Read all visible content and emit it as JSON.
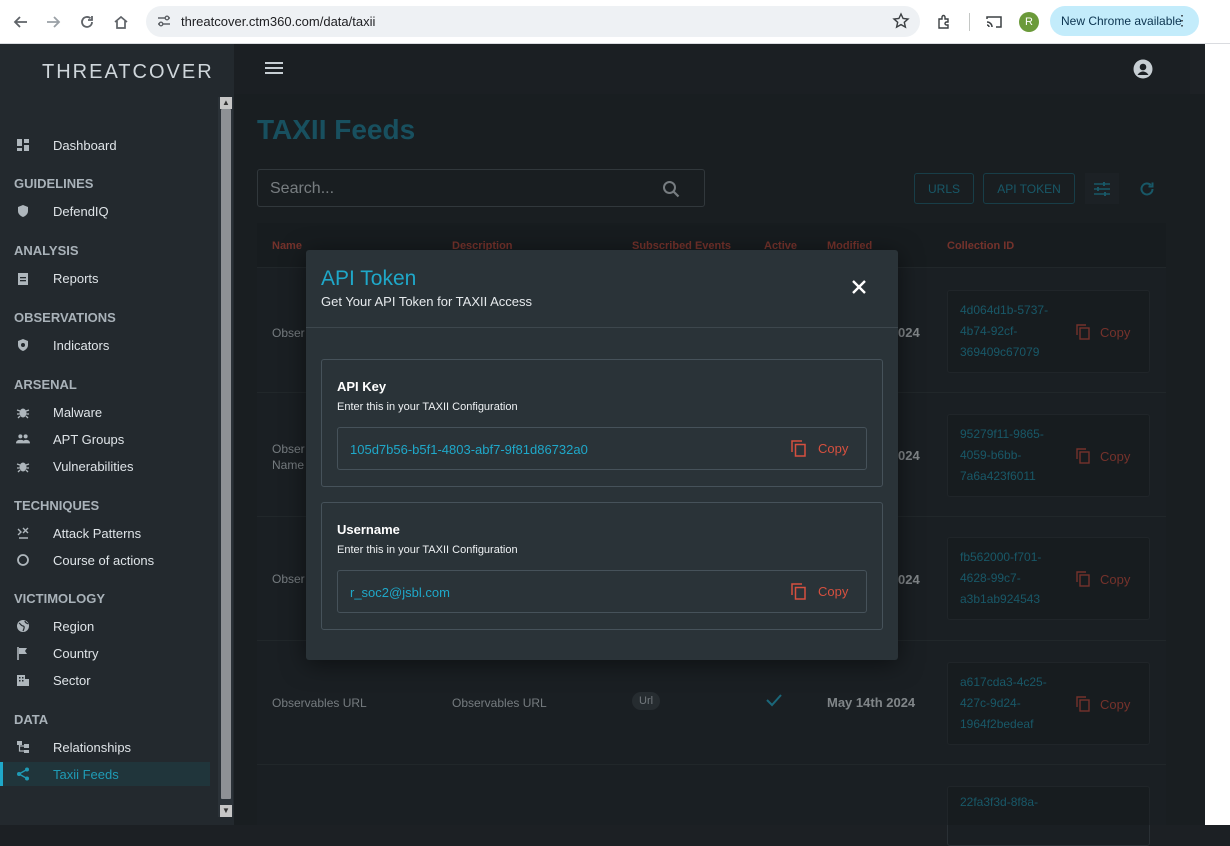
{
  "browser": {
    "url": "threatcover.ctm360.com/data/taxii",
    "profile_initial": "R",
    "update_label": "New Chrome available"
  },
  "app": {
    "brand": "THREATCOVER"
  },
  "sidebar": {
    "dashboard": "Dashboard",
    "sections": [
      {
        "title": "GUIDELINES",
        "items": [
          "DefendIQ"
        ]
      },
      {
        "title": "ANALYSIS",
        "items": [
          "Reports"
        ]
      },
      {
        "title": "OBSERVATIONS",
        "items": [
          "Indicators"
        ]
      },
      {
        "title": "ARSENAL",
        "items": [
          "Malware",
          "APT Groups",
          "Vulnerabilities"
        ]
      },
      {
        "title": "TECHNIQUES",
        "items": [
          "Attack Patterns",
          "Course of actions"
        ]
      },
      {
        "title": "VICTIMOLOGY",
        "items": [
          "Region",
          "Country",
          "Sector"
        ]
      },
      {
        "title": "DATA",
        "items": [
          "Relationships",
          "Taxii Feeds"
        ]
      }
    ],
    "active_item": "Taxii Feeds"
  },
  "page": {
    "title": "TAXII Feeds",
    "search_placeholder": "Search...",
    "urls_button": "URLS",
    "api_token_button": "API TOKEN"
  },
  "table": {
    "headers": {
      "name": "Name",
      "description": "Description",
      "subscribed_events": "Subscribed Events",
      "active": "Active",
      "modified": "Modified",
      "collection_id": "Collection ID"
    },
    "copy_label": "Copy",
    "rows": [
      {
        "name": "Obser",
        "date": "024",
        "collection_id": "4d064d1b-5737-4b74-92cf-369409c67079"
      },
      {
        "name": "Obser\nName",
        "date": "024",
        "collection_id": "95279f11-9865-4059-b6bb-7a6a423f6011"
      },
      {
        "name": "Obser",
        "date": "024",
        "collection_id": "fb562000-f701-4628-99c7-a3b1ab924543"
      },
      {
        "name": "Observables URL",
        "description": "Observables URL",
        "type": "Url",
        "date": "May 14th 2024",
        "collection_id": "a617cda3-4c25-427c-9d24-1964f2bedeaf"
      },
      {
        "collection_id": "22fa3f3d-8f8a-"
      }
    ]
  },
  "modal": {
    "title": "API Token",
    "subtitle": "Get Your API Token for TAXII Access",
    "api_key": {
      "label": "API Key",
      "hint": "Enter this in your TAXII Configuration",
      "value": "105d7b56-b5f1-4803-abf7-9f81d86732a0",
      "copy_label": "Copy"
    },
    "username": {
      "label": "Username",
      "hint": "Enter this in your TAXII Configuration",
      "value": "r_soc2@jsbl.com",
      "copy_label": "Copy"
    }
  },
  "colors": {
    "accent": "#1fa8c9",
    "danger": "#d6503f"
  }
}
